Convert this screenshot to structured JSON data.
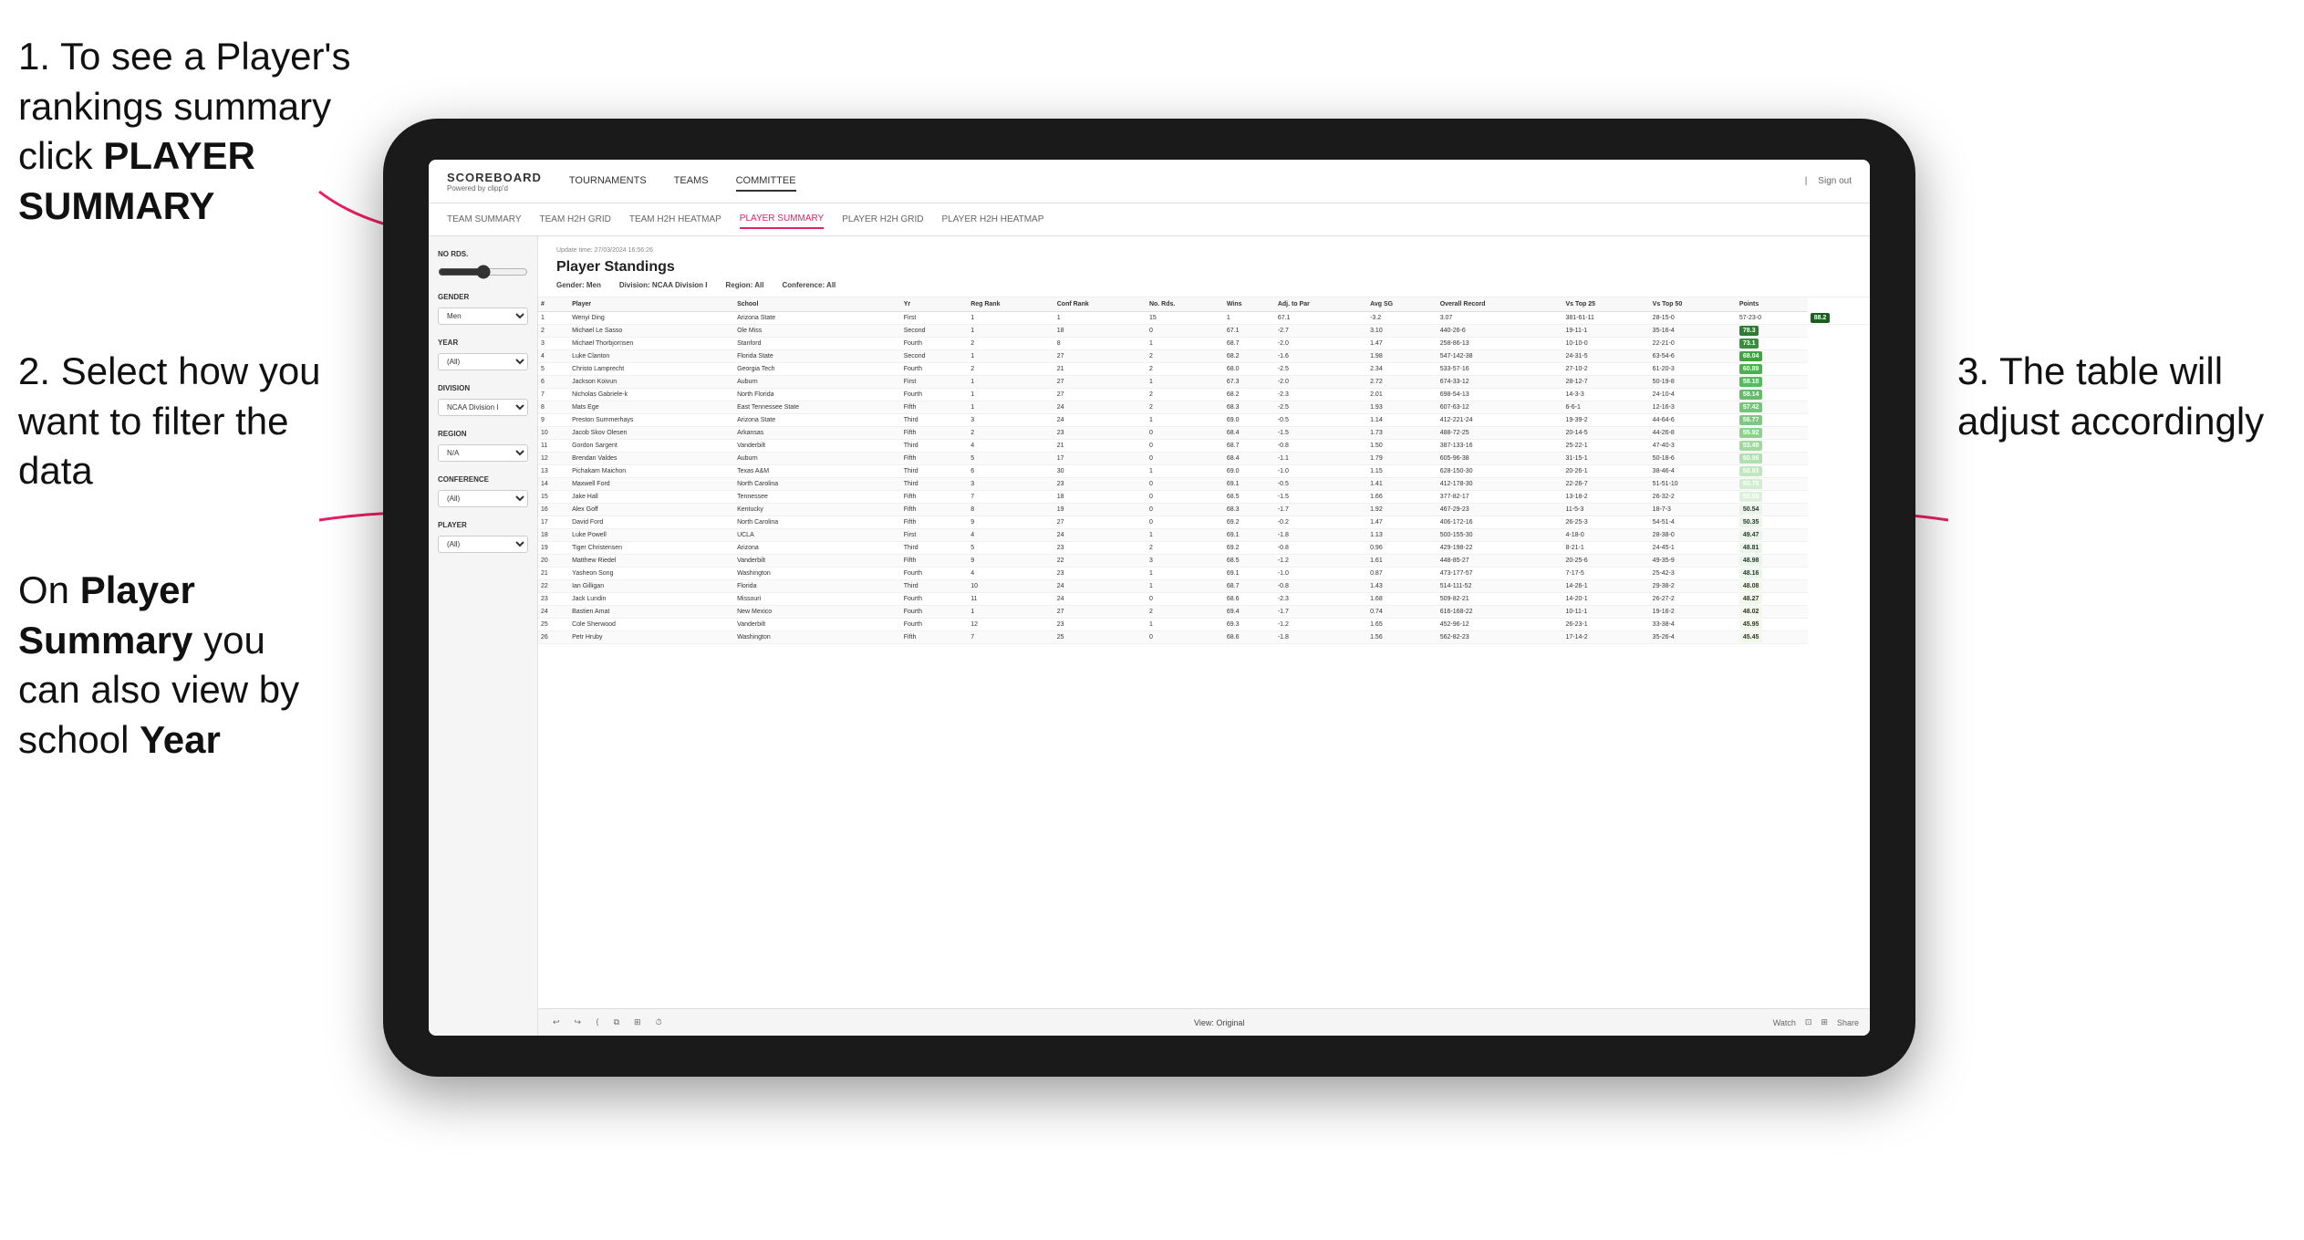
{
  "annotations": {
    "annotation1": "1. To see a Player's rankings summary click ",
    "annotation1_bold": "PLAYER SUMMARY",
    "annotation2": "2. Select how you want to filter the data",
    "annotation3_line1": "3. The table will",
    "annotation3_line2": "adjust accordingly",
    "annotation4_pre": "On ",
    "annotation4_bold1": "Player Summary",
    "annotation4_mid": " you can also view by school ",
    "annotation4_bold2": "Year"
  },
  "header": {
    "logo": "SCOREBOARD",
    "logo_sub": "Powered by clipp'd",
    "nav_items": [
      "TOURNAMENTS",
      "TEAMS",
      "COMMITTEE"
    ],
    "sign_in": "Sign out"
  },
  "sub_nav": {
    "items": [
      "TEAM SUMMARY",
      "TEAM H2H GRID",
      "TEAM H2H HEATMAP",
      "PLAYER SUMMARY",
      "PLAYER H2H GRID",
      "PLAYER H2H HEATMAP"
    ],
    "active": "PLAYER SUMMARY"
  },
  "sidebar": {
    "no_rds_label": "No Rds.",
    "gender_label": "Gender",
    "gender_value": "Men",
    "year_label": "Year",
    "year_value": "(All)",
    "division_label": "Division",
    "division_value": "NCAA Division I",
    "region_label": "Region",
    "region_value": "N/A",
    "conference_label": "Conference",
    "conference_value": "(All)",
    "player_label": "Player",
    "player_value": "(All)"
  },
  "content": {
    "title": "Player Standings",
    "update_time": "Update time: 27/03/2024 16:56:26",
    "gender": "Gender: Men",
    "division": "Division: NCAA Division I",
    "region": "Region: All",
    "conference": "Conference: All",
    "columns": [
      "#",
      "Player",
      "School",
      "Yr",
      "Reg Rank",
      "Conf Rank",
      "No. Rds.",
      "Wins",
      "Adj. to Par",
      "Avg SG",
      "Overall Record",
      "Vs Top 25",
      "Vs Top 50",
      "Points"
    ],
    "rows": [
      [
        "1",
        "Wenyi Ding",
        "Arizona State",
        "First",
        "1",
        "1",
        "15",
        "1",
        "67.1",
        "-3.2",
        "3.07",
        "381-61-11",
        "28-15-0",
        "57-23-0",
        "88.2"
      ],
      [
        "2",
        "Michael Le Sasso",
        "Ole Miss",
        "Second",
        "1",
        "18",
        "0",
        "67.1",
        "-2.7",
        "3.10",
        "440-26-6",
        "19-11-1",
        "35-16-4",
        "78.3"
      ],
      [
        "3",
        "Michael Thorbjornsen",
        "Stanford",
        "Fourth",
        "2",
        "8",
        "1",
        "68.7",
        "-2.0",
        "1.47",
        "258-86-13",
        "10-10-0",
        "22-21-0",
        "73.1"
      ],
      [
        "4",
        "Luke Clanton",
        "Florida State",
        "Second",
        "1",
        "27",
        "2",
        "68.2",
        "-1.6",
        "1.98",
        "547-142-38",
        "24-31-5",
        "63-54-6",
        "68.04"
      ],
      [
        "5",
        "Christo Lamprecht",
        "Georgia Tech",
        "Fourth",
        "2",
        "21",
        "2",
        "68.0",
        "-2.5",
        "2.34",
        "533-57-16",
        "27-10-2",
        "61-20-3",
        "60.89"
      ],
      [
        "6",
        "Jackson Koivun",
        "Auburn",
        "First",
        "1",
        "27",
        "1",
        "67.3",
        "-2.0",
        "2.72",
        "674-33-12",
        "28-12-7",
        "50-19-8",
        "58.18"
      ],
      [
        "7",
        "Nicholas Gabriele-k",
        "North Florida",
        "Fourth",
        "1",
        "27",
        "2",
        "68.2",
        "-2.3",
        "2.01",
        "698-54-13",
        "14-3-3",
        "24-10-4",
        "58.14"
      ],
      [
        "8",
        "Mats Ege",
        "East Tennessee State",
        "Fifth",
        "1",
        "24",
        "2",
        "68.3",
        "-2.5",
        "1.93",
        "607-63-12",
        "6-6-1",
        "12-16-3",
        "57.42"
      ],
      [
        "9",
        "Preston Summerhays",
        "Arizona State",
        "Third",
        "3",
        "24",
        "1",
        "69.0",
        "-0.5",
        "1.14",
        "412-221-24",
        "19-39-2",
        "44-64-6",
        "56.77"
      ],
      [
        "10",
        "Jacob Skov Olesen",
        "Arkansas",
        "Fifth",
        "2",
        "23",
        "0",
        "68.4",
        "-1.5",
        "1.73",
        "488-72-25",
        "20-14-5",
        "44-26-8",
        "55.92"
      ],
      [
        "11",
        "Gordon Sargent",
        "Vanderbilt",
        "Third",
        "4",
        "21",
        "0",
        "68.7",
        "-0.8",
        "1.50",
        "387-133-16",
        "25-22-1",
        "47-40-3",
        "53.49"
      ],
      [
        "12",
        "Brendan Valdes",
        "Auburn",
        "Fifth",
        "5",
        "17",
        "0",
        "68.4",
        "-1.1",
        "1.79",
        "605-96-38",
        "31-15-1",
        "50-18-6",
        "50.96"
      ],
      [
        "13",
        "Pichakam Maichon",
        "Texas A&M",
        "Third",
        "6",
        "30",
        "1",
        "69.0",
        "-1.0",
        "1.15",
        "628-150-30",
        "20-26-1",
        "38-46-4",
        "50.83"
      ],
      [
        "14",
        "Maxwell Ford",
        "North Carolina",
        "Third",
        "3",
        "23",
        "0",
        "69.1",
        "-0.5",
        "1.41",
        "412-178-30",
        "22-26-7",
        "51-51-10",
        "50.75"
      ],
      [
        "15",
        "Jake Hall",
        "Tennessee",
        "Fifth",
        "7",
        "18",
        "0",
        "68.5",
        "-1.5",
        "1.66",
        "377-82-17",
        "13-18-2",
        "26-32-2",
        "50.55"
      ],
      [
        "16",
        "Alex Goff",
        "Kentucky",
        "Fifth",
        "8",
        "19",
        "0",
        "68.3",
        "-1.7",
        "1.92",
        "467-29-23",
        "11-5-3",
        "18-7-3",
        "50.54"
      ],
      [
        "17",
        "David Ford",
        "North Carolina",
        "Fifth",
        "9",
        "27",
        "0",
        "69.2",
        "-0.2",
        "1.47",
        "406-172-16",
        "26-25-3",
        "54-51-4",
        "50.35"
      ],
      [
        "18",
        "Luke Powell",
        "UCLA",
        "First",
        "4",
        "24",
        "1",
        "69.1",
        "-1.8",
        "1.13",
        "500-155-30",
        "4-18-0",
        "28-38-0",
        "49.47"
      ],
      [
        "19",
        "Tiger Christensen",
        "Arizona",
        "Third",
        "5",
        "23",
        "2",
        "69.2",
        "-0.8",
        "0.96",
        "429-198-22",
        "8-21-1",
        "24-45-1",
        "48.81"
      ],
      [
        "20",
        "Matthew Riedel",
        "Vanderbilt",
        "Fifth",
        "9",
        "22",
        "3",
        "68.5",
        "-1.2",
        "1.61",
        "448-85-27",
        "20-25-6",
        "49-35-9",
        "48.98"
      ],
      [
        "21",
        "Yasheon Song",
        "Washington",
        "Fourth",
        "4",
        "23",
        "1",
        "69.1",
        "-1.0",
        "0.87",
        "473-177-57",
        "7-17-5",
        "25-42-3",
        "48.16"
      ],
      [
        "22",
        "Ian Gilligan",
        "Florida",
        "Third",
        "10",
        "24",
        "1",
        "68.7",
        "-0.8",
        "1.43",
        "514-111-52",
        "14-26-1",
        "29-38-2",
        "48.08"
      ],
      [
        "23",
        "Jack Lundin",
        "Missouri",
        "Fourth",
        "11",
        "24",
        "0",
        "68.6",
        "-2.3",
        "1.68",
        "509-82-21",
        "14-20-1",
        "26-27-2",
        "48.27"
      ],
      [
        "24",
        "Bastien Amat",
        "New Mexico",
        "Fourth",
        "1",
        "27",
        "2",
        "69.4",
        "-1.7",
        "0.74",
        "616-168-22",
        "10-11-1",
        "19-16-2",
        "48.02"
      ],
      [
        "25",
        "Cole Sherwood",
        "Vanderbilt",
        "Fourth",
        "12",
        "23",
        "1",
        "69.3",
        "-1.2",
        "1.65",
        "452-96-12",
        "26-23-1",
        "33-38-4",
        "45.95"
      ],
      [
        "26",
        "Petr Hruby",
        "Washington",
        "Fifth",
        "7",
        "25",
        "0",
        "68.6",
        "-1.8",
        "1.56",
        "562-82-23",
        "17-14-2",
        "35-26-4",
        "45.45"
      ]
    ]
  },
  "toolbar": {
    "view_label": "View: Original",
    "watch_label": "Watch",
    "share_label": "Share"
  }
}
